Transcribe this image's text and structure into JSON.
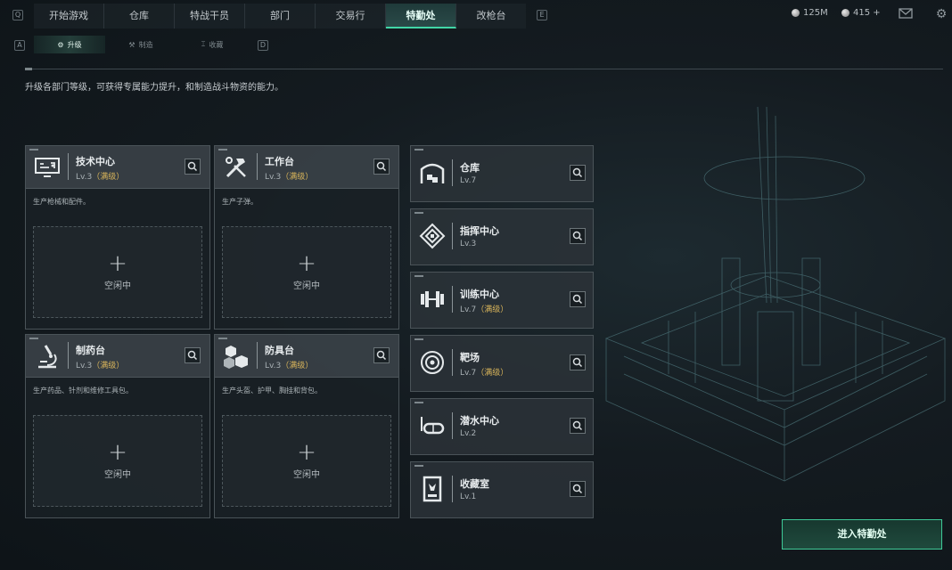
{
  "top_nav": {
    "left_key": "Q",
    "right_key": "E",
    "tabs": [
      "开始游戏",
      "仓库",
      "特战干员",
      "部门",
      "交易行",
      "特勤处",
      "改枪台"
    ],
    "currency_primary": "125M",
    "currency_secondary": "415 +"
  },
  "sub_nav": {
    "left_key": "A",
    "right_key": "D",
    "tabs": [
      "升级",
      "制造",
      "收藏"
    ]
  },
  "description": "升级各部门等级，可获得专属能力提升，和制造战斗物资的能力。",
  "cards": [
    {
      "title": "技术中心",
      "level": "Lv.3",
      "max": "（满级）",
      "desc": "生产枪械和配件。",
      "slot": "空闲中"
    },
    {
      "title": "工作台",
      "level": "Lv.3",
      "max": "（满级）",
      "desc": "生产子弹。",
      "slot": "空闲中"
    },
    {
      "title": "制药台",
      "level": "Lv.3",
      "max": "（满级）",
      "desc": "生产药品、针剂和维修工具包。",
      "slot": "空闲中"
    },
    {
      "title": "防具台",
      "level": "Lv.3",
      "max": "（满级）",
      "desc": "生产头盔、护甲、胸挂和背包。",
      "slot": "空闲中"
    }
  ],
  "list_items": [
    {
      "title": "仓库",
      "level": "Lv.7",
      "max": ""
    },
    {
      "title": "指挥中心",
      "level": "Lv.3",
      "max": ""
    },
    {
      "title": "训练中心",
      "level": "Lv.7",
      "max": "（满级）"
    },
    {
      "title": "靶场",
      "level": "Lv.7",
      "max": "（满级）"
    },
    {
      "title": "潜水中心",
      "level": "Lv.2",
      "max": ""
    },
    {
      "title": "收藏室",
      "level": "Lv.1",
      "max": ""
    }
  ],
  "enter_button": "进入特勤处",
  "colors": {
    "accent": "#41d6a6",
    "max_level": "#d8b45a"
  },
  "icons": [
    "mail-icon",
    "settings-gear-icon",
    "coin-icon",
    "search-icon",
    "plus-icon"
  ]
}
